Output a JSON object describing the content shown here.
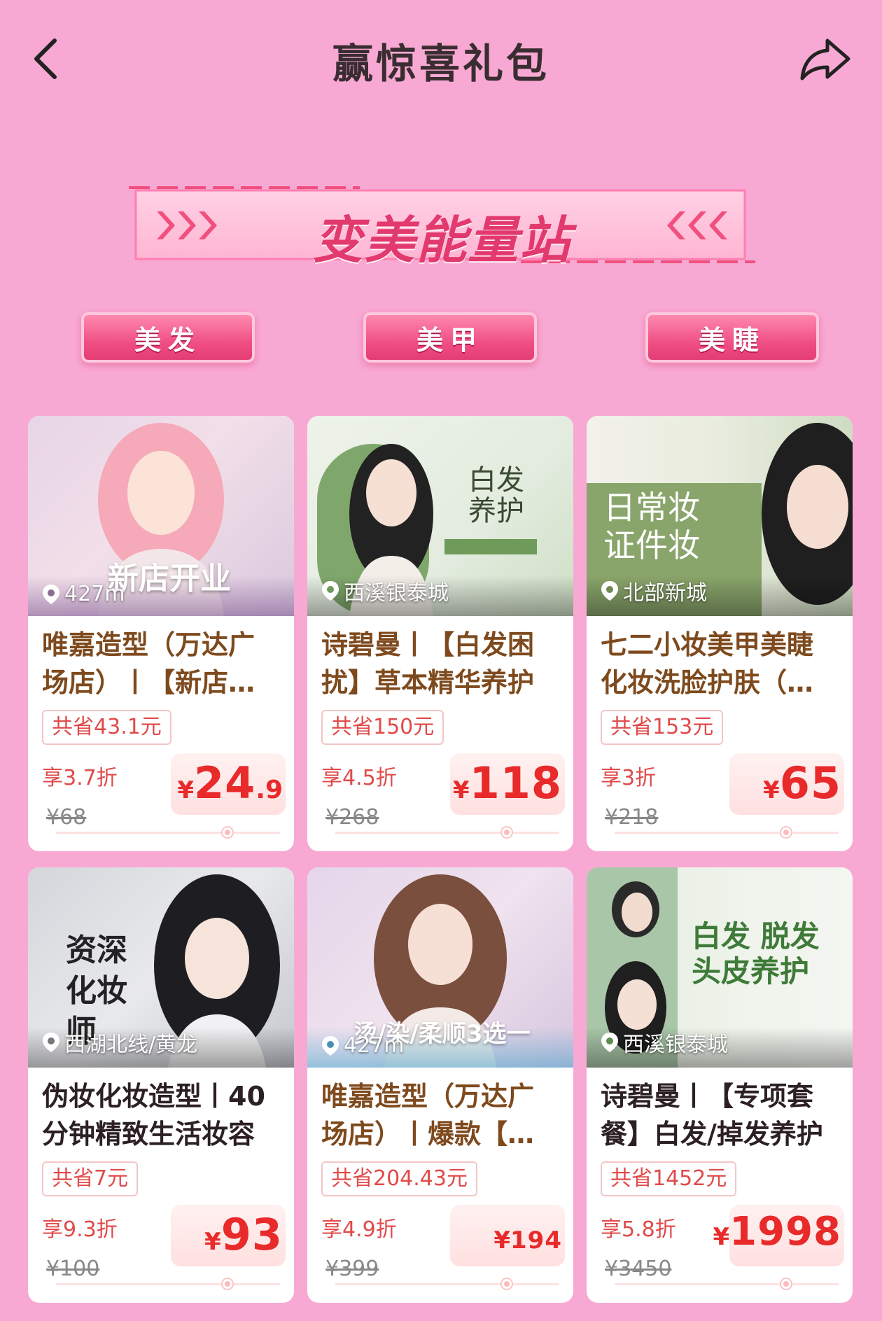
{
  "header": {
    "title": "赢惊喜礼包"
  },
  "banner": {
    "text": "变美能量站"
  },
  "categories": [
    {
      "label": "美发"
    },
    {
      "label": "美甲"
    },
    {
      "label": "美睫"
    }
  ],
  "cards": [
    {
      "location": "427m",
      "image_tag": "新店开业",
      "image_text": "",
      "name": "唯嘉造型（万达广场店）丨【新店开业】",
      "savings": "共省43.1元",
      "discount": "享3.7折",
      "original_price": "¥68",
      "price_symbol": "¥",
      "price_int": "24",
      "price_dec": ".9"
    },
    {
      "location": "西溪银泰城",
      "image_tag": "",
      "image_text": "白发养护",
      "name": "诗碧曼丨【白发困扰】草本精华养护",
      "savings": "共省150元",
      "discount": "享4.5折",
      "original_price": "¥268",
      "price_symbol": "¥",
      "price_int": "118",
      "price_dec": ""
    },
    {
      "location": "北部新城",
      "image_tag": "",
      "image_text": "日常妆 证件妆",
      "name": "七二小妆美甲美睫化妆洗脸护肤（日常妆）",
      "savings": "共省153元",
      "discount": "享3折",
      "original_price": "¥218",
      "price_symbol": "¥",
      "price_int": "65",
      "price_dec": ""
    },
    {
      "location": "西湖北线/黄龙",
      "image_tag": "",
      "image_text": "资深 化妆师",
      "name": "伪妆化妆造型丨40分钟精致生活妆容",
      "savings": "共省7元",
      "discount": "享9.3折",
      "original_price": "¥100",
      "price_symbol": "¥",
      "price_int": "93",
      "price_dec": ""
    },
    {
      "location": "427m",
      "image_tag": "烫/染/柔顺3选一",
      "image_text": "",
      "name": "唯嘉造型（万达广场店）丨爆款【烫染】",
      "savings": "共省204.43元",
      "discount": "享4.9折",
      "original_price": "¥399",
      "price_symbol": "¥",
      "price_int": "194",
      "price_dec": ""
    },
    {
      "location": "西溪银泰城",
      "image_tag": "",
      "image_text": "白发 脱发 头皮养护",
      "name": "诗碧曼丨【专项套餐】白发/掉发养护",
      "savings": "共省1452元",
      "discount": "享5.8折",
      "original_price": "¥3450",
      "price_symbol": "¥",
      "price_int": "1998",
      "price_dec": ""
    }
  ]
}
